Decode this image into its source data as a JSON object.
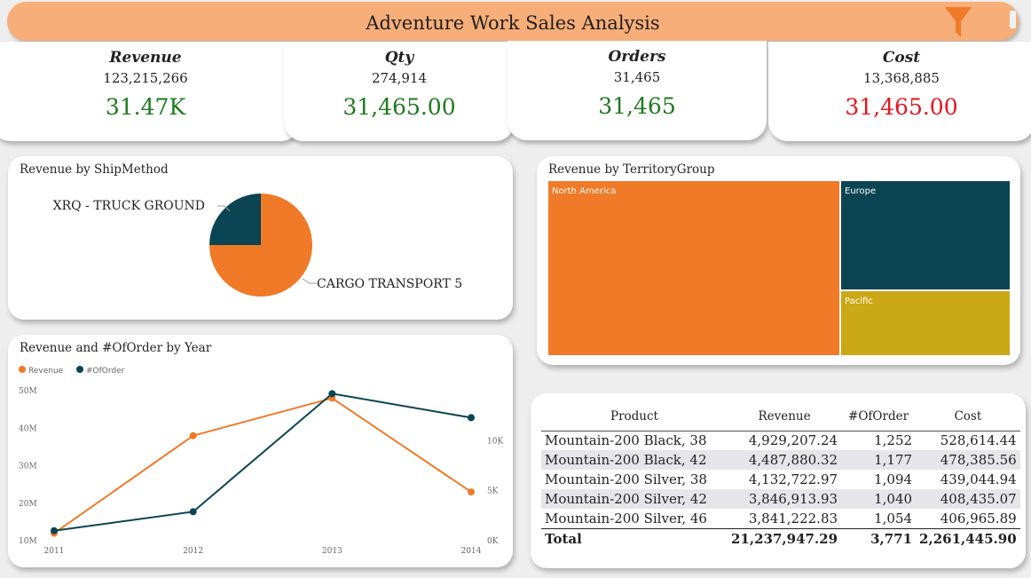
{
  "header": {
    "title": "Adventure Work Sales Analysis",
    "filter_icon": "filter-icon",
    "accent": "#f7ae78"
  },
  "kpis": [
    {
      "label": "Revenue",
      "total": "123,215,266",
      "value": "31.47K",
      "value_color": "#1e7a1e"
    },
    {
      "label": "Qty",
      "total": "274,914",
      "value": "31,465.00",
      "value_color": "#1e7a1e"
    },
    {
      "label": "Orders",
      "total": "31,465",
      "value": "31,465",
      "value_color": "#1e7a1e"
    },
    {
      "label": "Cost",
      "total": "13,368,885",
      "value": "31,465.00",
      "value_color": "#e8141c"
    }
  ],
  "pie": {
    "title": "Revenue by ShipMethod",
    "chart_data": {
      "type": "pie",
      "slices": [
        {
          "label": "CARGO TRANSPORT 5",
          "share": 0.75,
          "color": "#f07a28"
        },
        {
          "label": "XRQ - TRUCK GROUND",
          "share": 0.25,
          "color": "#0b4452"
        }
      ]
    }
  },
  "treemap": {
    "title": "Revenue by TerritoryGroup",
    "chart_data": {
      "type": "treemap",
      "groups": [
        {
          "label": "North America",
          "share": 0.63,
          "color": "#f07a28"
        },
        {
          "label": "Europe",
          "share": 0.23,
          "color": "#0b4452"
        },
        {
          "label": "Pacific",
          "share": 0.14,
          "color": "#cba916"
        }
      ]
    }
  },
  "line": {
    "title": "Revenue and #OfOrder by Year",
    "chart_data": {
      "type": "line",
      "x": [
        2011,
        2012,
        2013,
        2014
      ],
      "x_ticks": [
        "2011",
        "2012",
        "2013",
        "2014"
      ],
      "series": [
        {
          "name": "Revenue",
          "axis": "left",
          "color": "#f07a28",
          "values": [
            12000000,
            38000000,
            48000000,
            23000000
          ]
        },
        {
          "name": "#OfOrder",
          "axis": "right",
          "color": "#0b4452",
          "values": [
            1000,
            2900,
            14700,
            12300
          ]
        }
      ],
      "y_left": {
        "ticks": [
          "10M",
          "20M",
          "30M",
          "40M",
          "50M"
        ],
        "range": [
          10000000,
          50000000
        ]
      },
      "y_right": {
        "ticks": [
          "0K",
          "5K",
          "10K"
        ],
        "range": [
          0,
          15000
        ]
      },
      "legend_position": "top-left",
      "grid": false
    }
  },
  "table": {
    "columns": [
      "Product",
      "Revenue",
      "#OfOrder",
      "Cost"
    ],
    "rows": [
      [
        "Mountain-200 Black, 38",
        "4,929,207.24",
        "1,252",
        "528,614.44"
      ],
      [
        "Mountain-200 Black, 42",
        "4,487,880.32",
        "1,177",
        "478,385.56"
      ],
      [
        "Mountain-200 Silver, 38",
        "4,132,722.97",
        "1,094",
        "439,044.94"
      ],
      [
        "Mountain-200 Silver, 42",
        "3,846,913.93",
        "1,040",
        "408,435.07"
      ],
      [
        "Mountain-200 Silver, 46",
        "3,841,222.83",
        "1,054",
        "406,965.89"
      ]
    ],
    "total": [
      "Total",
      "21,237,947.29",
      "3,771",
      "2,261,445.90"
    ]
  }
}
